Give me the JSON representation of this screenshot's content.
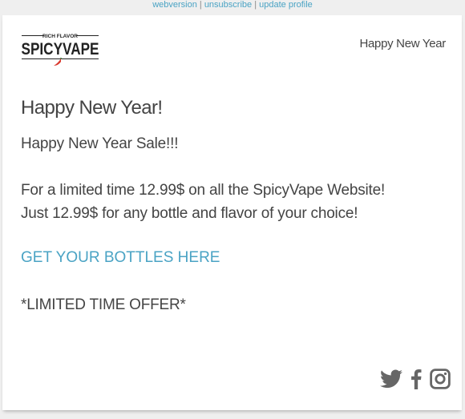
{
  "top_links": {
    "webversion": "webversion",
    "sep1": " | ",
    "unsubscribe": "unsubscribe",
    "sep2": " | ",
    "update_profile": "update profile"
  },
  "brand": {
    "name": "SPICYVAPE",
    "tagline": "RICH FLAVOR",
    "accent_color": "#d9362b",
    "link_color": "#4aa3c4",
    "text_color": "#444444"
  },
  "header": {
    "title": "Happy New Year"
  },
  "content": {
    "heading": "Happy New Year!",
    "line1": "Happy New Year Sale!!!",
    "line2": "For a limited time 12.99$ on all the SpicyVape Website!",
    "line3": "Just 12.99$ for any bottle and flavor of your choice!",
    "cta": "GET YOUR BOTTLES HERE",
    "offer": "*LIMITED TIME OFFER*"
  },
  "social_icons": [
    "twitter-icon",
    "facebook-icon",
    "instagram-icon"
  ]
}
